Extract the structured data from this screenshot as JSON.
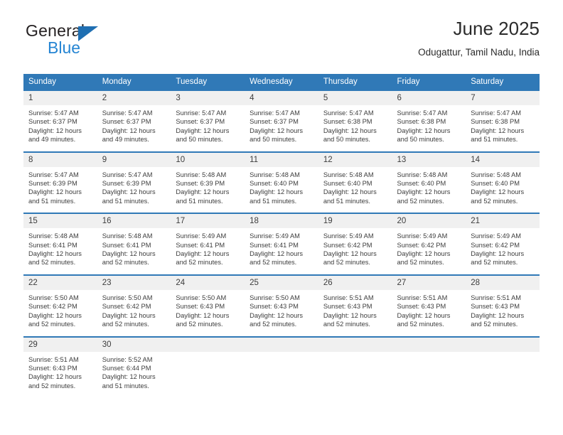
{
  "brand": {
    "word1": "General",
    "word2": "Blue"
  },
  "header": {
    "title": "June 2025",
    "location": "Odugattur, Tamil Nadu, India"
  },
  "weekday_headers": [
    "Sunday",
    "Monday",
    "Tuesday",
    "Wednesday",
    "Thursday",
    "Friday",
    "Saturday"
  ],
  "colors": {
    "header_blue": "#3079b7",
    "daynum_band": "#f0f0f0",
    "brand_blue": "#2585d3",
    "text": "#3d3d3d"
  },
  "weeks": [
    [
      {
        "day": "1",
        "sunrise": "Sunrise: 5:47 AM",
        "sunset": "Sunset: 6:37 PM",
        "daylight1": "Daylight: 12 hours",
        "daylight2": "and 49 minutes."
      },
      {
        "day": "2",
        "sunrise": "Sunrise: 5:47 AM",
        "sunset": "Sunset: 6:37 PM",
        "daylight1": "Daylight: 12 hours",
        "daylight2": "and 49 minutes."
      },
      {
        "day": "3",
        "sunrise": "Sunrise: 5:47 AM",
        "sunset": "Sunset: 6:37 PM",
        "daylight1": "Daylight: 12 hours",
        "daylight2": "and 50 minutes."
      },
      {
        "day": "4",
        "sunrise": "Sunrise: 5:47 AM",
        "sunset": "Sunset: 6:37 PM",
        "daylight1": "Daylight: 12 hours",
        "daylight2": "and 50 minutes."
      },
      {
        "day": "5",
        "sunrise": "Sunrise: 5:47 AM",
        "sunset": "Sunset: 6:38 PM",
        "daylight1": "Daylight: 12 hours",
        "daylight2": "and 50 minutes."
      },
      {
        "day": "6",
        "sunrise": "Sunrise: 5:47 AM",
        "sunset": "Sunset: 6:38 PM",
        "daylight1": "Daylight: 12 hours",
        "daylight2": "and 50 minutes."
      },
      {
        "day": "7",
        "sunrise": "Sunrise: 5:47 AM",
        "sunset": "Sunset: 6:38 PM",
        "daylight1": "Daylight: 12 hours",
        "daylight2": "and 51 minutes."
      }
    ],
    [
      {
        "day": "8",
        "sunrise": "Sunrise: 5:47 AM",
        "sunset": "Sunset: 6:39 PM",
        "daylight1": "Daylight: 12 hours",
        "daylight2": "and 51 minutes."
      },
      {
        "day": "9",
        "sunrise": "Sunrise: 5:47 AM",
        "sunset": "Sunset: 6:39 PM",
        "daylight1": "Daylight: 12 hours",
        "daylight2": "and 51 minutes."
      },
      {
        "day": "10",
        "sunrise": "Sunrise: 5:48 AM",
        "sunset": "Sunset: 6:39 PM",
        "daylight1": "Daylight: 12 hours",
        "daylight2": "and 51 minutes."
      },
      {
        "day": "11",
        "sunrise": "Sunrise: 5:48 AM",
        "sunset": "Sunset: 6:40 PM",
        "daylight1": "Daylight: 12 hours",
        "daylight2": "and 51 minutes."
      },
      {
        "day": "12",
        "sunrise": "Sunrise: 5:48 AM",
        "sunset": "Sunset: 6:40 PM",
        "daylight1": "Daylight: 12 hours",
        "daylight2": "and 51 minutes."
      },
      {
        "day": "13",
        "sunrise": "Sunrise: 5:48 AM",
        "sunset": "Sunset: 6:40 PM",
        "daylight1": "Daylight: 12 hours",
        "daylight2": "and 52 minutes."
      },
      {
        "day": "14",
        "sunrise": "Sunrise: 5:48 AM",
        "sunset": "Sunset: 6:40 PM",
        "daylight1": "Daylight: 12 hours",
        "daylight2": "and 52 minutes."
      }
    ],
    [
      {
        "day": "15",
        "sunrise": "Sunrise: 5:48 AM",
        "sunset": "Sunset: 6:41 PM",
        "daylight1": "Daylight: 12 hours",
        "daylight2": "and 52 minutes."
      },
      {
        "day": "16",
        "sunrise": "Sunrise: 5:48 AM",
        "sunset": "Sunset: 6:41 PM",
        "daylight1": "Daylight: 12 hours",
        "daylight2": "and 52 minutes."
      },
      {
        "day": "17",
        "sunrise": "Sunrise: 5:49 AM",
        "sunset": "Sunset: 6:41 PM",
        "daylight1": "Daylight: 12 hours",
        "daylight2": "and 52 minutes."
      },
      {
        "day": "18",
        "sunrise": "Sunrise: 5:49 AM",
        "sunset": "Sunset: 6:41 PM",
        "daylight1": "Daylight: 12 hours",
        "daylight2": "and 52 minutes."
      },
      {
        "day": "19",
        "sunrise": "Sunrise: 5:49 AM",
        "sunset": "Sunset: 6:42 PM",
        "daylight1": "Daylight: 12 hours",
        "daylight2": "and 52 minutes."
      },
      {
        "day": "20",
        "sunrise": "Sunrise: 5:49 AM",
        "sunset": "Sunset: 6:42 PM",
        "daylight1": "Daylight: 12 hours",
        "daylight2": "and 52 minutes."
      },
      {
        "day": "21",
        "sunrise": "Sunrise: 5:49 AM",
        "sunset": "Sunset: 6:42 PM",
        "daylight1": "Daylight: 12 hours",
        "daylight2": "and 52 minutes."
      }
    ],
    [
      {
        "day": "22",
        "sunrise": "Sunrise: 5:50 AM",
        "sunset": "Sunset: 6:42 PM",
        "daylight1": "Daylight: 12 hours",
        "daylight2": "and 52 minutes."
      },
      {
        "day": "23",
        "sunrise": "Sunrise: 5:50 AM",
        "sunset": "Sunset: 6:42 PM",
        "daylight1": "Daylight: 12 hours",
        "daylight2": "and 52 minutes."
      },
      {
        "day": "24",
        "sunrise": "Sunrise: 5:50 AM",
        "sunset": "Sunset: 6:43 PM",
        "daylight1": "Daylight: 12 hours",
        "daylight2": "and 52 minutes."
      },
      {
        "day": "25",
        "sunrise": "Sunrise: 5:50 AM",
        "sunset": "Sunset: 6:43 PM",
        "daylight1": "Daylight: 12 hours",
        "daylight2": "and 52 minutes."
      },
      {
        "day": "26",
        "sunrise": "Sunrise: 5:51 AM",
        "sunset": "Sunset: 6:43 PM",
        "daylight1": "Daylight: 12 hours",
        "daylight2": "and 52 minutes."
      },
      {
        "day": "27",
        "sunrise": "Sunrise: 5:51 AM",
        "sunset": "Sunset: 6:43 PM",
        "daylight1": "Daylight: 12 hours",
        "daylight2": "and 52 minutes."
      },
      {
        "day": "28",
        "sunrise": "Sunrise: 5:51 AM",
        "sunset": "Sunset: 6:43 PM",
        "daylight1": "Daylight: 12 hours",
        "daylight2": "and 52 minutes."
      }
    ],
    [
      {
        "day": "29",
        "sunrise": "Sunrise: 5:51 AM",
        "sunset": "Sunset: 6:43 PM",
        "daylight1": "Daylight: 12 hours",
        "daylight2": "and 52 minutes."
      },
      {
        "day": "30",
        "sunrise": "Sunrise: 5:52 AM",
        "sunset": "Sunset: 6:44 PM",
        "daylight1": "Daylight: 12 hours",
        "daylight2": "and 51 minutes."
      },
      {
        "day": "",
        "sunrise": "",
        "sunset": "",
        "daylight1": "",
        "daylight2": ""
      },
      {
        "day": "",
        "sunrise": "",
        "sunset": "",
        "daylight1": "",
        "daylight2": ""
      },
      {
        "day": "",
        "sunrise": "",
        "sunset": "",
        "daylight1": "",
        "daylight2": ""
      },
      {
        "day": "",
        "sunrise": "",
        "sunset": "",
        "daylight1": "",
        "daylight2": ""
      },
      {
        "day": "",
        "sunrise": "",
        "sunset": "",
        "daylight1": "",
        "daylight2": ""
      }
    ]
  ]
}
